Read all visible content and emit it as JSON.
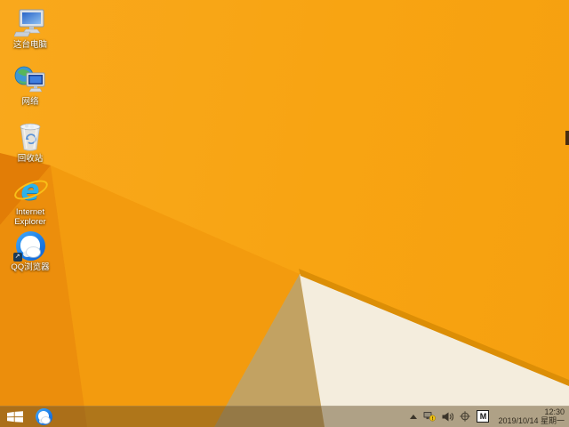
{
  "desktop": {
    "icons": [
      {
        "name": "this-pc",
        "label": "这台电脑"
      },
      {
        "name": "network",
        "label": "网络"
      },
      {
        "name": "recycle-bin",
        "label": "回收站"
      },
      {
        "name": "internet-explorer",
        "label": "Internet Explorer"
      },
      {
        "name": "qq-browser",
        "label": "QQ浏览器"
      }
    ],
    "wallpaper_colors": {
      "base_orange": "#F8A412",
      "dark_wedge": "#E27D06",
      "left_fold": "#EC8E0C",
      "mid_fold": "#F39B0E",
      "tan_shadow": "#C2A262",
      "cream_triangle": "#F4EDDD",
      "gold_edge": "#DC8E06"
    }
  },
  "taskbar": {
    "pinned": [
      {
        "name": "qq-browser"
      }
    ],
    "tray": {
      "icons": [
        "show-hidden-chevron",
        "network-warning",
        "volume",
        "crosshair",
        "input-method"
      ],
      "input_indicator": "M",
      "time": "12:30",
      "date": "2019/10/14 星期一"
    }
  }
}
